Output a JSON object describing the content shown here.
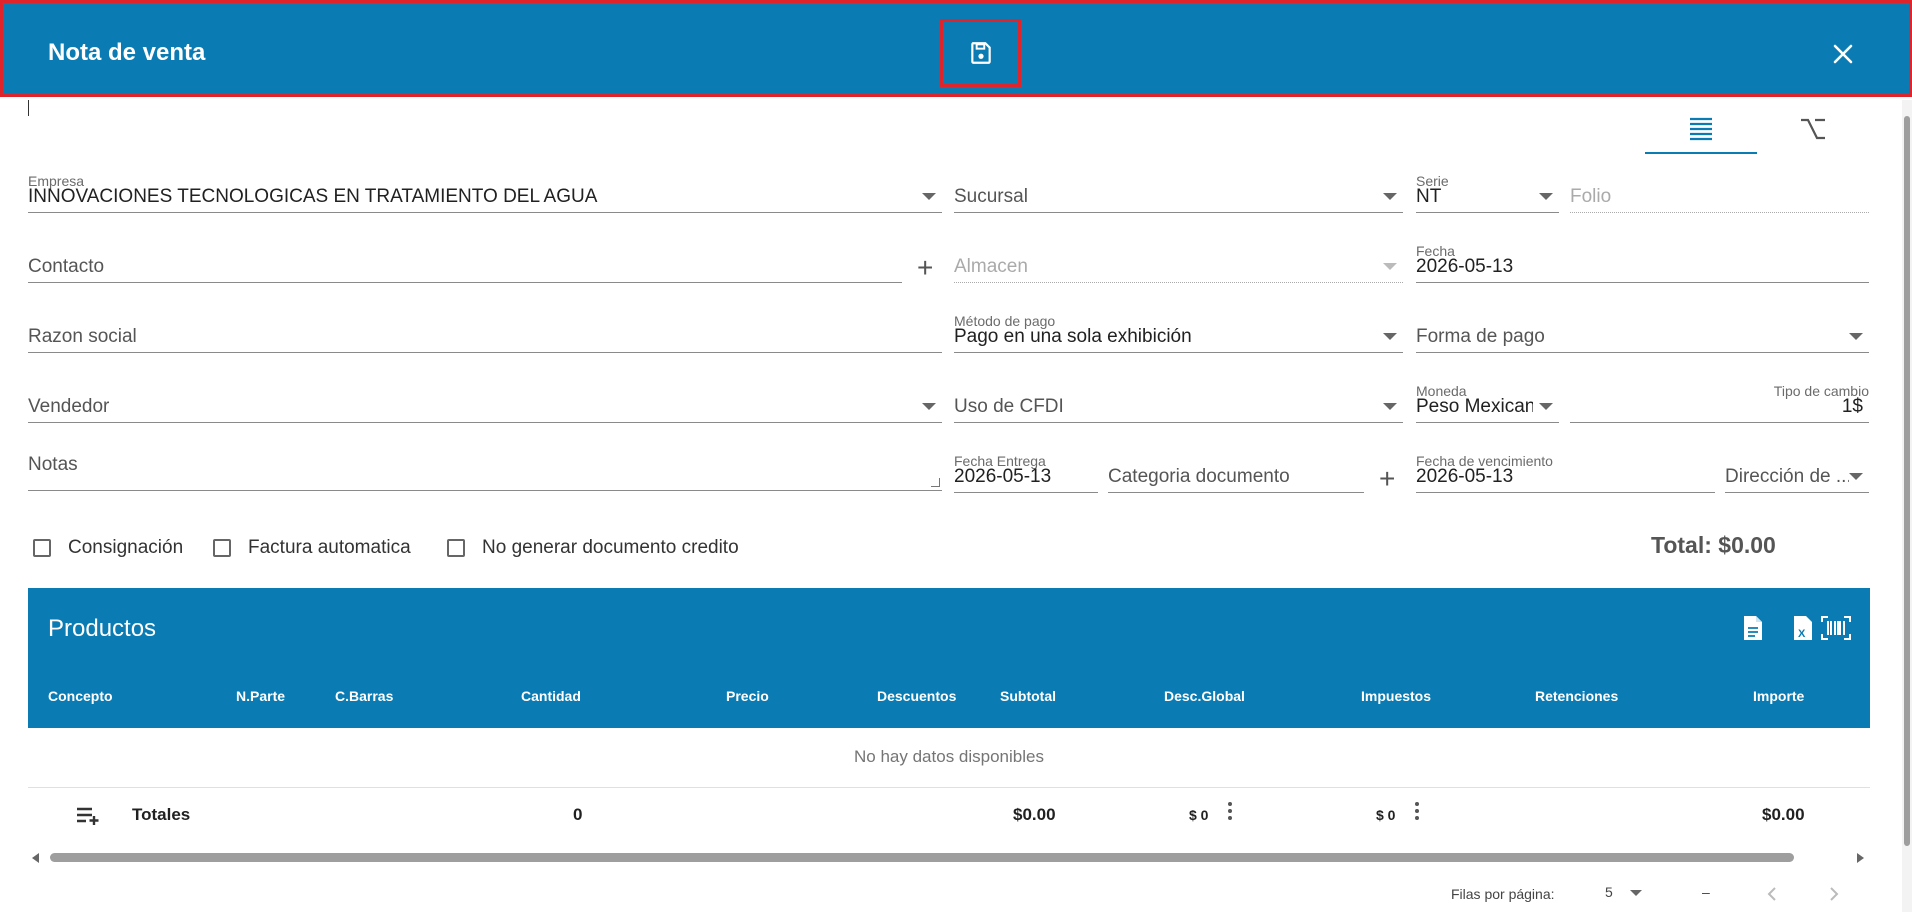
{
  "header": {
    "title": "Nota de venta",
    "save_icon": "save-icon",
    "close_icon": "close-icon",
    "bg_color": "#0a7cb3",
    "highlight_color": "#e0242b"
  },
  "view_tabs": [
    {
      "icon": "list-view-icon",
      "active": true
    },
    {
      "icon": "formula-view-icon",
      "active": false
    }
  ],
  "form": {
    "empresa": {
      "label": "Empresa",
      "value": "INNOVACIONES TECNOLOGICAS EN TRATAMIENTO DEL AGUA"
    },
    "sucursal": {
      "placeholder": "Sucursal"
    },
    "serie": {
      "label": "Serie",
      "value": "NT"
    },
    "folio": {
      "placeholder": "Folio"
    },
    "contacto": {
      "placeholder": "Contacto"
    },
    "almacen": {
      "placeholder": "Almacen"
    },
    "fecha": {
      "label": "Fecha",
      "value": "2026-05-13"
    },
    "razon_social": {
      "placeholder": "Razon social"
    },
    "metodo_pago": {
      "label": "Método de pago",
      "value": "Pago en una sola exhibición"
    },
    "forma_pago": {
      "placeholder": "Forma de pago"
    },
    "vendedor": {
      "placeholder": "Vendedor"
    },
    "uso_cfdi": {
      "placeholder": "Uso de CFDI"
    },
    "moneda": {
      "label": "Moneda",
      "value": "Peso Mexicano"
    },
    "tipo_cambio": {
      "label": "Tipo de cambio",
      "value": "1$"
    },
    "notas": {
      "placeholder": "Notas"
    },
    "fecha_entrega": {
      "label": "Fecha Entrega",
      "value": "2026-05-13"
    },
    "categoria": {
      "placeholder": "Categoria documento"
    },
    "fecha_vencimiento": {
      "label": "Fecha de vencimiento",
      "value": "2026-05-13"
    },
    "direccion": {
      "placeholder": "Dirección de ..."
    }
  },
  "checkboxes": {
    "consignacion": "Consignación",
    "factura_automatica": "Factura automatica",
    "no_generar": "No generar documento credito"
  },
  "total_label": "Total: $0.00",
  "products": {
    "title": "Productos",
    "columns": [
      "Concepto",
      "N.Parte",
      "C.Barras",
      "Cantidad",
      "Precio",
      "Descuentos",
      "Subtotal",
      "Desc.Global",
      "Impuestos",
      "Retenciones",
      "Importe"
    ],
    "empty_text": "No hay datos disponibles",
    "totals": {
      "label": "Totales",
      "cantidad": "0",
      "subtotal": "$0.00",
      "desc_global": "$ 0",
      "impuestos": "$ 0",
      "importe": "$0.00"
    },
    "pager": {
      "rows_label": "Filas por página:",
      "rows_value": "5",
      "range": "–"
    }
  }
}
